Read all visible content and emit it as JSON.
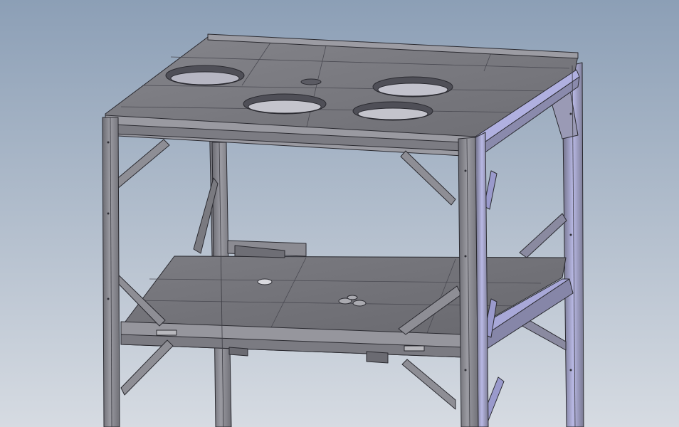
{
  "scene": {
    "subject": "steel-frame-two-level-platform-cad-model",
    "colors": {
      "background_top": "#8c9fb6",
      "background_bottom": "#d6dbe2",
      "steel_face": "#8d8d93",
      "steel_dark": "#5c5c64",
      "steel_light": "#a9a9b0",
      "steel_edge_highlight": "#c8c8f0",
      "plate_top": "#7a7a80",
      "plate_dark": "#5f5f66",
      "outline": "#2a2a30"
    },
    "top_deck_holes": 5,
    "lower_deck_holes": 4
  }
}
